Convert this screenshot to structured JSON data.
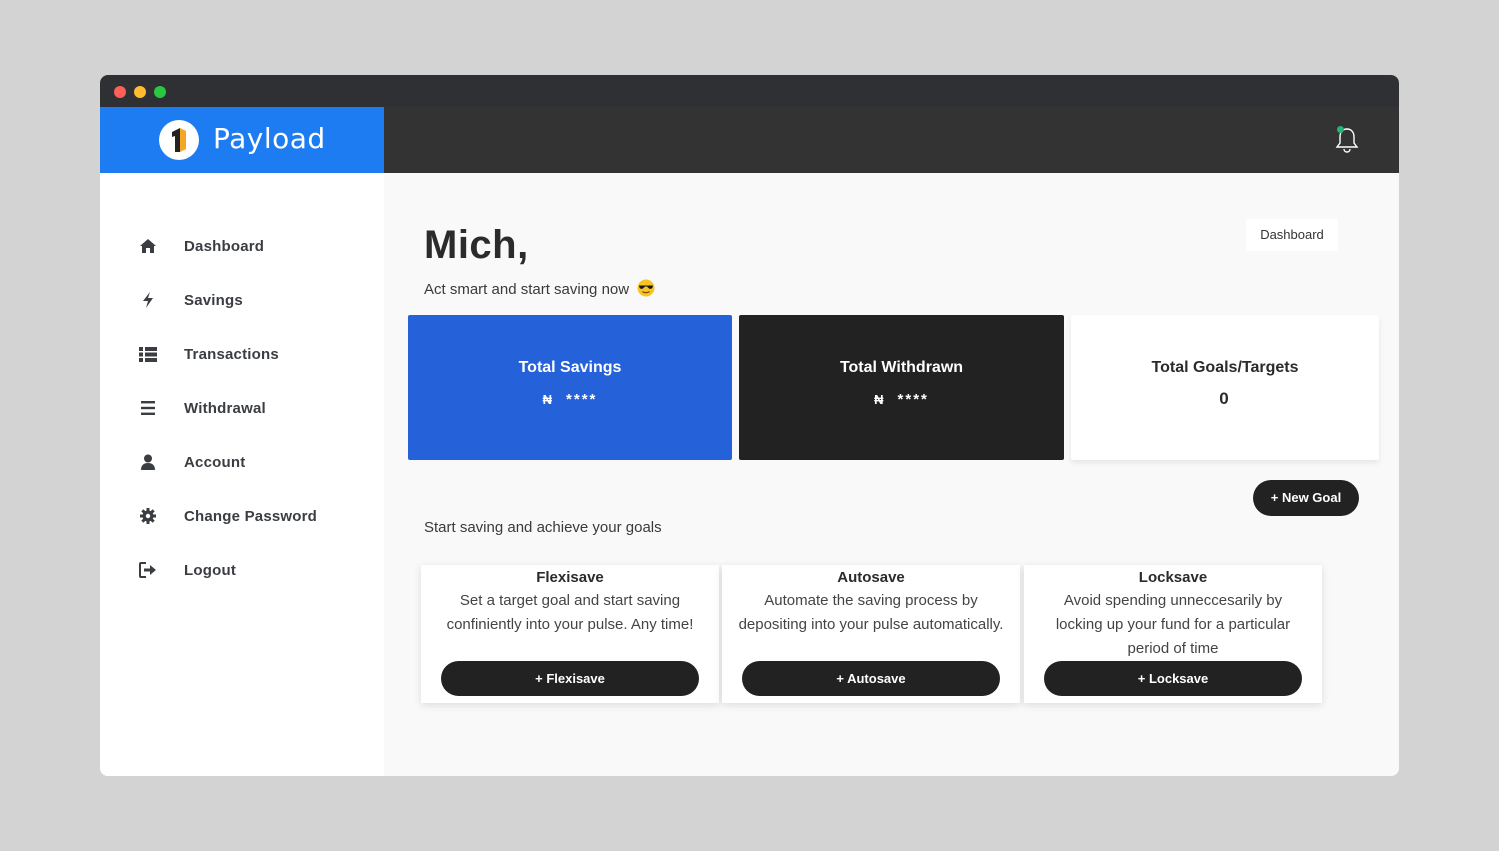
{
  "app": {
    "name": "Payload"
  },
  "colors": {
    "brand": "#1e7cf2",
    "topbar": "#333333",
    "card_blue": "#2562d9",
    "card_dark": "#222222"
  },
  "sidebar": {
    "items": [
      {
        "label": "Dashboard",
        "icon": "home-icon"
      },
      {
        "label": "Savings",
        "icon": "bolt-icon"
      },
      {
        "label": "Transactions",
        "icon": "list-icon"
      },
      {
        "label": "Withdrawal",
        "icon": "bars-icon"
      },
      {
        "label": "Account",
        "icon": "user-icon"
      },
      {
        "label": "Change Password",
        "icon": "gear-icon"
      },
      {
        "label": "Logout",
        "icon": "logout-icon"
      }
    ]
  },
  "header": {
    "notification_icon": "bell-icon"
  },
  "main": {
    "greeting": "Mich,",
    "subtitle": "Act smart and start saving now",
    "subtitle_emoji": "sunglasses-emoji",
    "breadcrumb": "Dashboard",
    "stats": [
      {
        "title": "Total Savings",
        "currency": "₦",
        "value": "****"
      },
      {
        "title": "Total Withdrawn",
        "currency": "₦",
        "value": "****"
      },
      {
        "title": "Total Goals/Targets",
        "value": "0"
      }
    ],
    "new_goal_label": "+ New Goal",
    "section_text": "Start saving and achieve your goals",
    "plans": [
      {
        "title": "Flexisave",
        "description": "Set a target goal and start saving confiniently into your pulse. Any time!",
        "button": "+ Flexisave"
      },
      {
        "title": "Autosave",
        "description": "Automate the saving process by depositing into your pulse automatically.",
        "button": "+ Autosave"
      },
      {
        "title": "Locksave",
        "description": "Avoid spending unneccesarily by locking up your fund for a particular period of time",
        "button": "+ Locksave"
      }
    ]
  }
}
